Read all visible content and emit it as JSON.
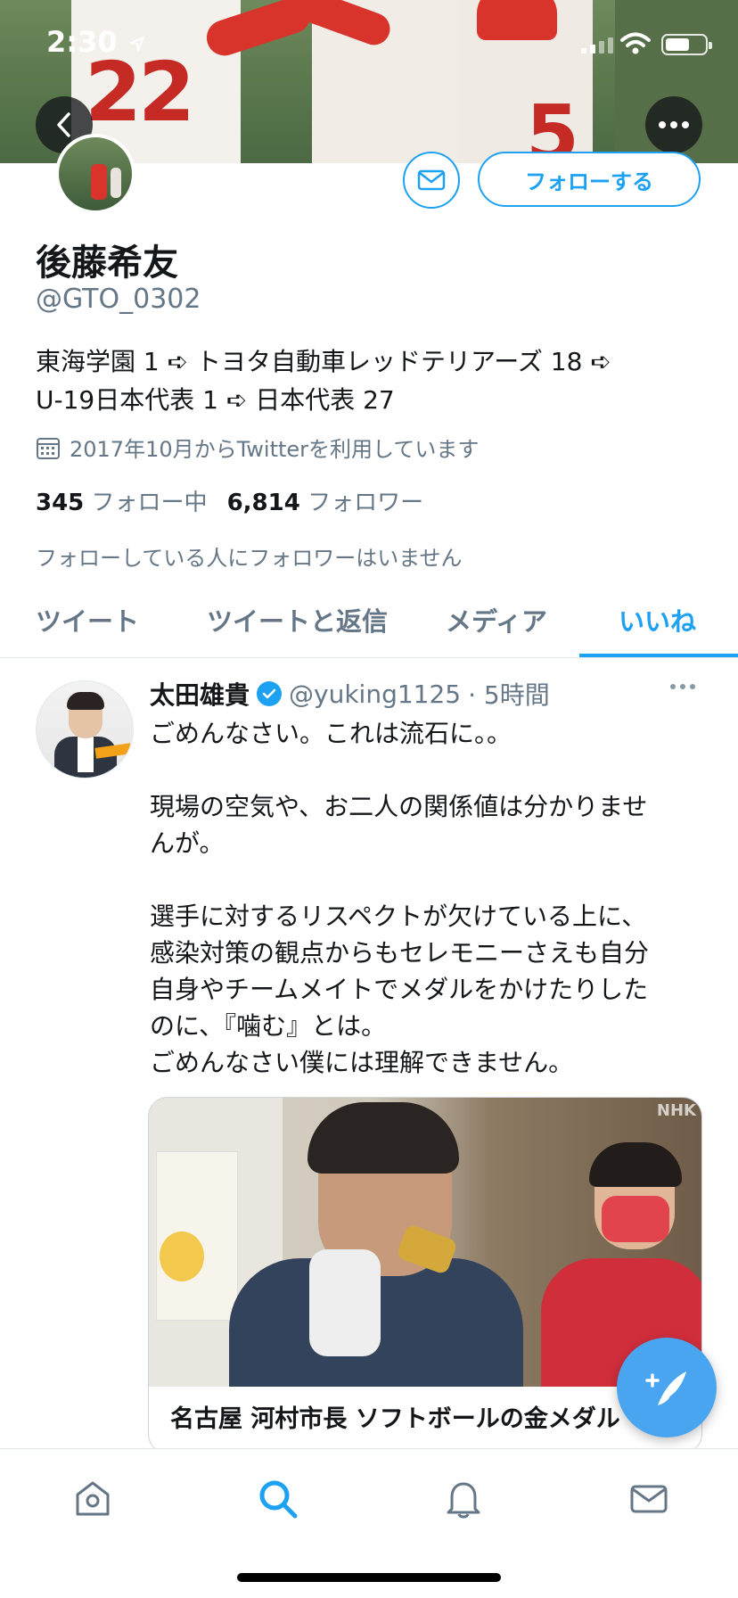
{
  "status_bar": {
    "time": "2:30"
  },
  "profile": {
    "name": "後藤希友",
    "handle": "@GTO_0302",
    "bio_lines": [
      "東海学園 1 ➪ トヨタ自動車レッドテリアーズ 18 ➪",
      "U-19日本代表 1 ➪ 日本代表 27"
    ],
    "joined": "2017年10月からTwitterを利用しています",
    "following_count": "345",
    "following_label": "フォロー中",
    "followers_count": "6,814",
    "followers_label": "フォロワー",
    "followed_by_text": "フォローしている人にフォロワーはいません",
    "follow_button_label": "フォローする",
    "banner_numbers": [
      "22",
      "5"
    ]
  },
  "tabs": [
    {
      "label": "ツイート",
      "active": false
    },
    {
      "label": "ツイートと返信",
      "active": false
    },
    {
      "label": "メディア",
      "active": false
    },
    {
      "label": "いいね",
      "active": true
    }
  ],
  "tweet": {
    "author_name": "太田雄貴",
    "author_handle": "@yuking1125",
    "time_ago": "· 5時間",
    "verified": true,
    "body_lines": [
      "ごめんなさい。これは流石に。。",
      "",
      "現場の空気や、お二人の関係値は分かりませ",
      "んが。",
      "",
      "選手に対するリスペクトが欠けている上に、",
      "感染対策の観点からもセレモニーさえも自分",
      "自身やチームメイトでメダルをかけたりした",
      "のに、『噛む』とは。",
      "ごめんなさい僕には理解できません。"
    ],
    "card": {
      "watermark": "NHK",
      "title": "名古屋 河村市長 ソフトボールの金メダル"
    }
  },
  "icons": {
    "back": "chevron-left-icon",
    "more": "more-horizontal-icon",
    "message": "envelope-icon",
    "calendar": "calendar-icon",
    "compose": "compose-tweet-icon",
    "nav": [
      "home-icon",
      "search-icon",
      "bell-icon",
      "mail-icon"
    ]
  },
  "colors": {
    "accent": "#1da1f2",
    "text_primary": "#14171a",
    "text_secondary": "#657786",
    "fab": "#4aa5f0"
  }
}
